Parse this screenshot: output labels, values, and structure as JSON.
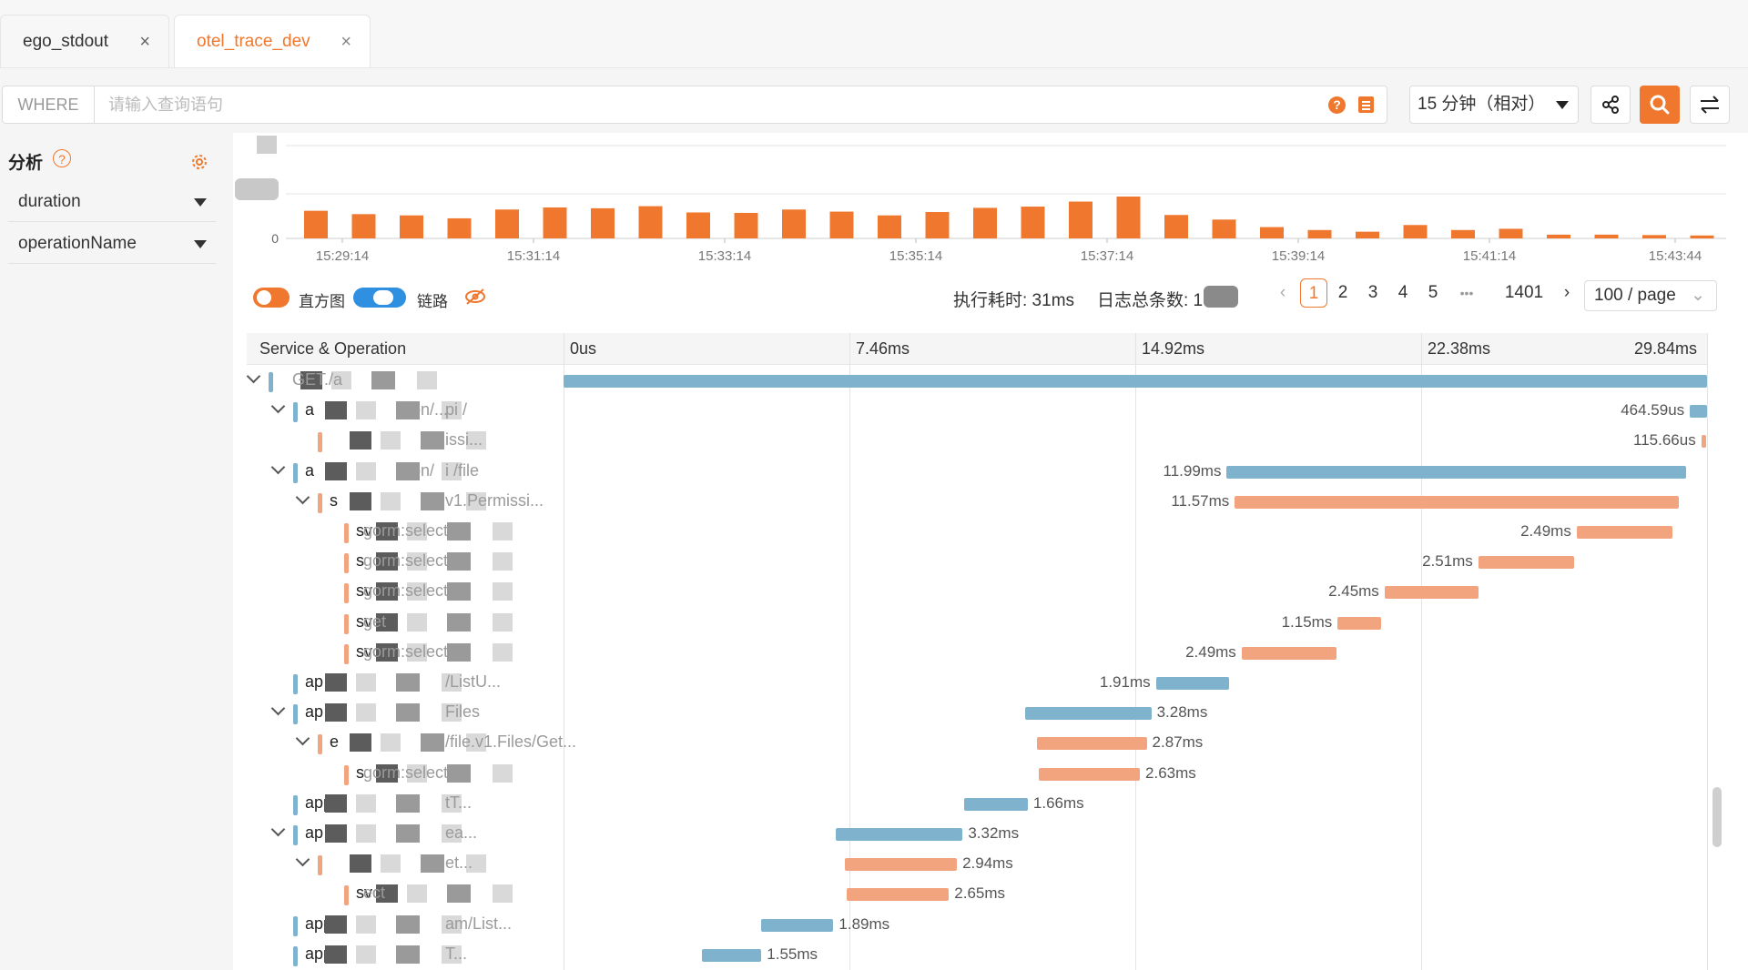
{
  "tabs": [
    {
      "label": "ego_stdout",
      "active": false
    },
    {
      "label": "otel_trace_dev",
      "active": true
    }
  ],
  "query": {
    "prefix": "WHERE",
    "placeholder": "请输入查询语句"
  },
  "time_range": "15 分钟（相对）",
  "analysis": {
    "title": "分析",
    "fields": [
      "duration",
      "operationName"
    ]
  },
  "histogram": {
    "y_tick": "0",
    "x_ticks": [
      "15:29:14",
      "15:31:14",
      "15:33:14",
      "15:35:14",
      "15:37:14",
      "15:39:14",
      "15:41:14",
      "15:43:44"
    ],
    "bar_levels": [
      0.66,
      0.58,
      0.55,
      0.48,
      0.69,
      0.74,
      0.72,
      0.77,
      0.62,
      0.61,
      0.69,
      0.64,
      0.55,
      0.63,
      0.73,
      0.76,
      0.88,
      1.0,
      0.56,
      0.45,
      0.27,
      0.2,
      0.16,
      0.32,
      0.2,
      0.23,
      0.09,
      0.09,
      0.08,
      0.07
    ],
    "color": "#f0782e"
  },
  "controls": {
    "histogram_label": "直方图",
    "trace_label": "链路",
    "exec_time": "执行耗时: 31ms",
    "log_total": "日志总条数: 1"
  },
  "pagination": {
    "pages": [
      "1",
      "2",
      "3",
      "4",
      "5"
    ],
    "ellipsis": "•••",
    "last": "1401",
    "page_size": "100 / page"
  },
  "trace_table": {
    "headers": [
      "Service & Operation",
      "0us",
      "7.46ms",
      "14.92ms",
      "22.38ms",
      "29.84ms"
    ],
    "rows": [
      {
        "svc": "",
        "op": "GET./a",
        "dur": "",
        "color": "blue",
        "chev": true,
        "level": 0,
        "start": 0.0,
        "width": 1.0
      },
      {
        "svc": "a",
        "op": "pi /",
        "op2": "sion/...",
        "dur": "464.59us",
        "color": "blue",
        "chev": true,
        "level": 1,
        "start": 0.985,
        "width": 0.015
      },
      {
        "svc": "",
        "op": "issi...",
        "dur": "115.66us",
        "color": "orange",
        "chev": false,
        "level": 2,
        "start": 0.995,
        "width": 0.004
      },
      {
        "svc": "a",
        "op": "i /file",
        "op2": "sion/",
        "dur": "11.99ms",
        "color": "blue",
        "chev": true,
        "level": 1,
        "start": 0.58,
        "width": 0.402
      },
      {
        "svc": "s",
        "op": "v1.Permissi...",
        "dur": "11.57ms",
        "color": "orange",
        "chev": true,
        "level": 2,
        "start": 0.587,
        "width": 0.388
      },
      {
        "svc": "sv",
        "op": "gorm:select",
        "dur": "2.49ms",
        "color": "orange",
        "chev": false,
        "level": 3,
        "start": 0.886,
        "width": 0.084
      },
      {
        "svc": "s",
        "op": "gorm:select",
        "dur": "2.51ms",
        "color": "orange",
        "chev": false,
        "level": 3,
        "start": 0.8,
        "width": 0.084
      },
      {
        "svc": "sv",
        "op": "gorm:select",
        "dur": "2.45ms",
        "color": "orange",
        "chev": false,
        "level": 3,
        "start": 0.718,
        "width": 0.082
      },
      {
        "svc": "sv",
        "op": "get",
        "dur": "1.15ms",
        "color": "orange",
        "chev": false,
        "level": 3,
        "start": 0.677,
        "width": 0.038
      },
      {
        "svc": "svc",
        "op": "gorm:select",
        "dur": "2.49ms",
        "color": "orange",
        "chev": false,
        "level": 3,
        "start": 0.593,
        "width": 0.083
      },
      {
        "svc": "ap",
        "op": "/ListU...",
        "dur": "1.91ms",
        "color": "blue",
        "chev": false,
        "level": 1,
        "start": 0.518,
        "width": 0.064
      },
      {
        "svc": "ap",
        "op": "Files",
        "dur": "3.28ms",
        "color": "blue",
        "chev": true,
        "level": 1,
        "start": 0.404,
        "width": 0.11,
        "label_right": true
      },
      {
        "svc": "e",
        "op": "/file.v1.Files/Get...",
        "dur": "2.87ms",
        "color": "orange",
        "chev": true,
        "level": 2,
        "start": 0.414,
        "width": 0.096,
        "label_right": true
      },
      {
        "svc": "s",
        "op": "gorm:select",
        "dur": "2.63ms",
        "color": "orange",
        "chev": false,
        "level": 3,
        "start": 0.416,
        "width": 0.088,
        "label_right": true
      },
      {
        "svc": "app-",
        "op": "tT...",
        "dur": "1.66ms",
        "color": "blue",
        "chev": false,
        "level": 1,
        "start": 0.35,
        "width": 0.056,
        "label_right": true
      },
      {
        "svc": "ap",
        "op": "ea...",
        "dur": "3.32ms",
        "color": "blue",
        "chev": true,
        "level": 1,
        "start": 0.238,
        "width": 0.111,
        "label_right": true
      },
      {
        "svc": "",
        "op": "et...",
        "dur": "2.94ms",
        "color": "orange",
        "chev": true,
        "level": 2,
        "start": 0.246,
        "width": 0.098,
        "label_right": true
      },
      {
        "svc": "svc",
        "op": "ect",
        "dur": "2.65ms",
        "color": "orange",
        "chev": false,
        "level": 3,
        "start": 0.248,
        "width": 0.089,
        "label_right": true
      },
      {
        "svc": "app",
        "op": "am/List...",
        "dur": "1.89ms",
        "color": "blue",
        "chev": false,
        "level": 1,
        "start": 0.173,
        "width": 0.063,
        "label_right": true
      },
      {
        "svc": "app",
        "op": "T...",
        "dur": "1.55ms",
        "color": "blue",
        "chev": false,
        "level": 1,
        "start": 0.121,
        "width": 0.052,
        "label_right": true
      }
    ]
  }
}
